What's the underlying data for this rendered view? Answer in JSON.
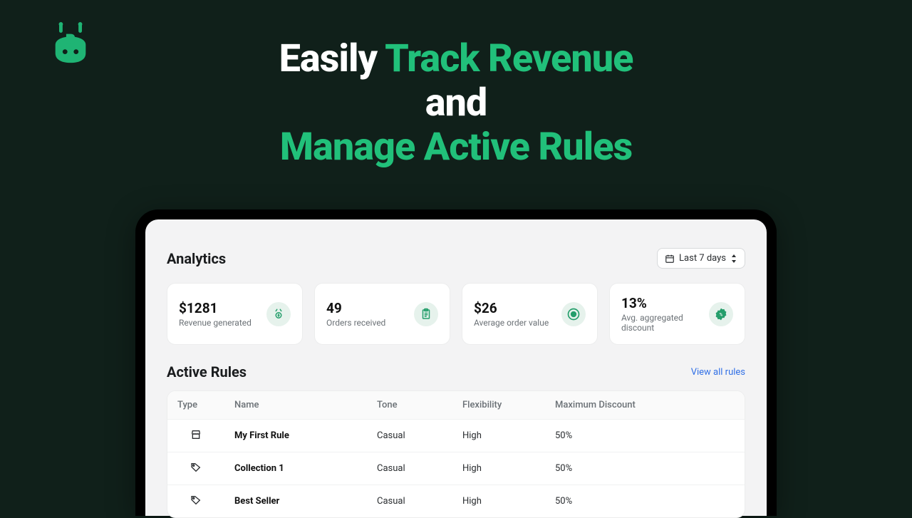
{
  "headline": {
    "part1": "Easily ",
    "part2": "Track Revenue",
    "part3": "and",
    "part4": "Manage Active Rules"
  },
  "analytics": {
    "title": "Analytics",
    "date_range": "Last 7 days",
    "stats": [
      {
        "value": "$1281",
        "label": "Revenue generated"
      },
      {
        "value": "49",
        "label": "Orders received"
      },
      {
        "value": "$26",
        "label": "Average order value"
      },
      {
        "value": "13%",
        "label": "Avg. aggregated discount"
      }
    ]
  },
  "rules": {
    "title": "Active Rules",
    "view_all": "View all rules",
    "columns": {
      "type": "Type",
      "name": "Name",
      "tone": "Tone",
      "flex": "Flexibility",
      "max": "Maximum Discount"
    },
    "rows": [
      {
        "icon": "store",
        "name": "My First Rule",
        "tone": "Casual",
        "flex": "High",
        "max": "50%"
      },
      {
        "icon": "tag",
        "name": "Collection 1",
        "tone": "Casual",
        "flex": "High",
        "max": "50%"
      },
      {
        "icon": "tag",
        "name": "Best Seller",
        "tone": "Casual",
        "flex": "High",
        "max": "50%"
      }
    ]
  }
}
